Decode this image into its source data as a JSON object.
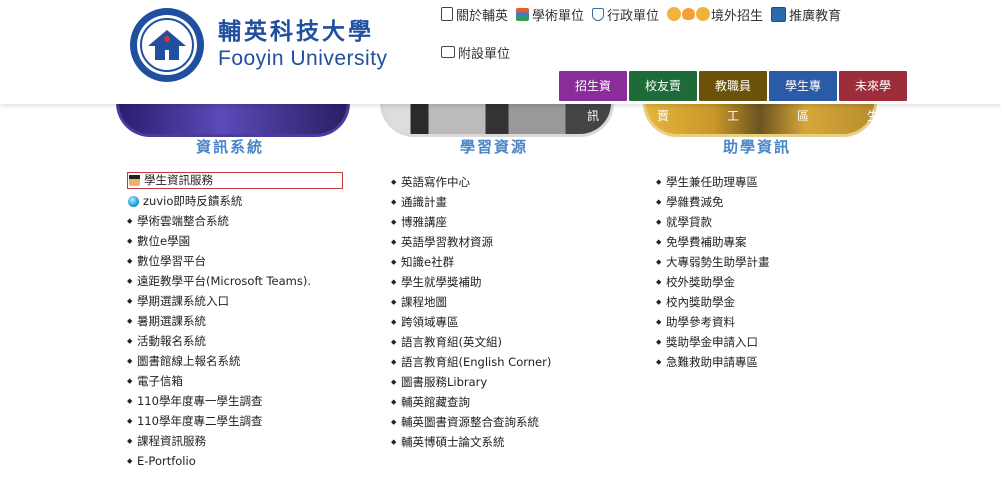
{
  "logo": {
    "cn": "輔英科技大學",
    "en": "Fooyin University"
  },
  "topnav": {
    "row1": [
      {
        "label": "關於輔英",
        "icon": "doc-icon"
      },
      {
        "label": "學術單位",
        "icon": "books-icon"
      },
      {
        "label": "行政單位",
        "icon": "cup-icon"
      },
      {
        "label": "境外招生",
        "icon": "people-icon"
      },
      {
        "label": "推廣教育",
        "icon": "chart-icon"
      }
    ],
    "row2": [
      {
        "label": "附設單位",
        "icon": "box-icon"
      }
    ]
  },
  "buttons": [
    "招生資訊",
    "校友賣賣",
    "教職員工",
    "學生專區",
    "未來學生"
  ],
  "columns": [
    {
      "title": "資訊系統",
      "items": [
        "學生資訊服務",
        "zuvio即時反饋系統",
        "學術雲端整合系統",
        "數位e學園",
        "數位學習平台",
        "遠距教學平台(Microsoft Teams).",
        "學期選課系統入口",
        "暑期選課系統",
        "活動報名系統",
        "圖書館線上報名系統",
        "電子信箱",
        "110學年度專一學生調查",
        "110學年度專二學生調查",
        "課程資訊服務",
        "E-Portfolio"
      ]
    },
    {
      "title": "學習資源",
      "items": [
        "英語寫作中心",
        "通識計畫",
        "博雅講座",
        "英語學習教材資源",
        "知識e社群",
        "學生就學獎補助",
        "課程地圖",
        "跨領域專區",
        "語言教育組(英文組)",
        "語言教育組(English Corner)",
        "圖書服務Library",
        "輔英館藏查詢",
        "輔英圖書資源整合查詢系統",
        "輔英博碩士論文系統"
      ]
    },
    {
      "title": "助學資訊",
      "items": [
        "學生兼任助理專區",
        "學雜費減免",
        "就學貸款",
        "免學費補助專案",
        "大專弱勢生助學計畫",
        "校外獎助學金",
        "校內獎助學金",
        "助學參考資料",
        "獎助學金申請入口",
        "急難救助申請專區"
      ]
    }
  ]
}
